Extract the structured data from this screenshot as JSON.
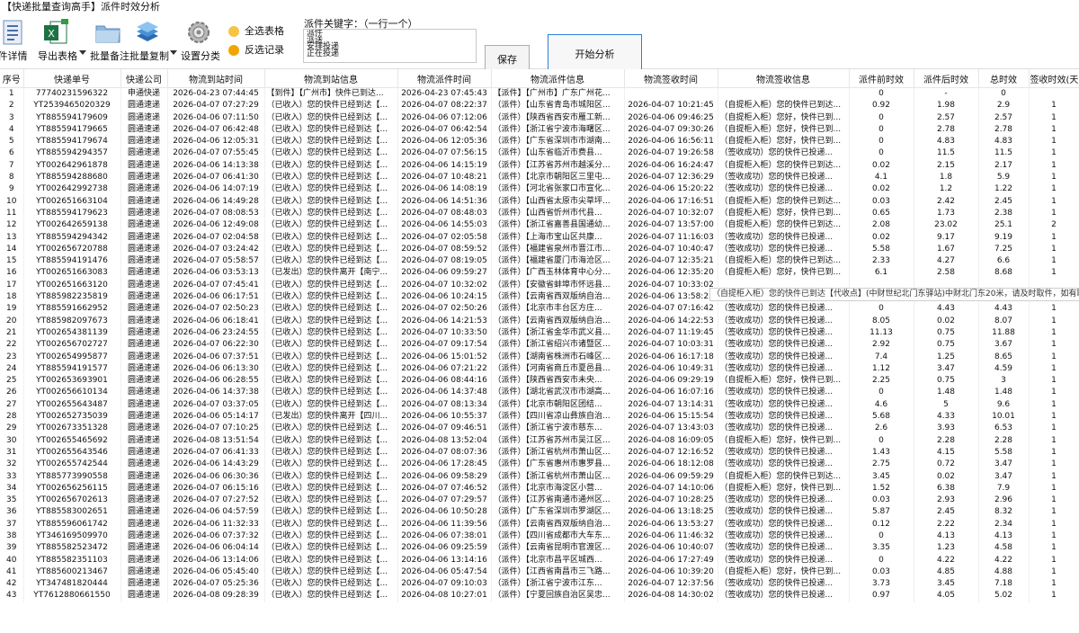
{
  "window_title": "【快递批量查询高手】派件时效分析",
  "toolbar": {
    "detail_label": "件详情",
    "export_label": "导出表格",
    "backup_label": "批量备注",
    "copy_label": "批量复制",
    "settings_label": "设置分类",
    "select_all_label": "全选表格",
    "invert_label": "反选记录",
    "keyword_label": "派件关键字：（一行一个）",
    "keywords": "派件\n派送\n安排投递\n正在投递",
    "save_label": "保存",
    "start_label": "开始分析"
  },
  "table": {
    "headers": [
      "序号",
      "快递单号",
      "快递公司",
      "物流到站时间",
      "物流到站信息",
      "物流派件时间",
      "物流派件信息",
      "物流签收时间",
      "物流签收信息",
      "派件前时效",
      "派件后时效",
      "总时效",
      "签收时效(天)"
    ],
    "rows": [
      [
        "1",
        "77740231596322",
        "申通快递",
        "2026-04-23 07:44:45",
        "【到件】【广州市】快件已到达...",
        "2026-04-23 07:45:43",
        "【派件】【广州市】广东广州花...",
        "",
        "",
        "0",
        "-",
        "0",
        ""
      ],
      [
        "2",
        "YT2539465020329",
        "圆通速递",
        "2026-04-07 07:27:29",
        "（已收入）您的快件已经到达【...",
        "2026-04-07 08:22:37",
        "（派件）【山东省青岛市城阳区...",
        "2026-04-07 10:21:45",
        "（自提柜入柜）您的快件已到达...",
        "0.92",
        "1.98",
        "2.9",
        "1"
      ],
      [
        "3",
        "YT885594179609",
        "圆通速递",
        "2026-04-06 07:11:50",
        "（已收入）您的快件已经到达【...",
        "2026-04-06 07:12:06",
        "（派件）【陕西省西安市雁工新...",
        "2026-04-06 09:46:25",
        "（自提柜入柜）您好，快件已到...",
        "0",
        "2.57",
        "2.57",
        "1"
      ],
      [
        "4",
        "YT885594179665",
        "圆通速递",
        "2026-04-07 06:42:48",
        "（已收入）您的快件已经到达【...",
        "2026-04-07 06:42:54",
        "（派件）【浙江省宁波市海曙区...",
        "2026-04-07 09:30:26",
        "（自提柜入柜）您好，快件已到...",
        "0",
        "2.78",
        "2.78",
        "1"
      ],
      [
        "5",
        "YT885594179674",
        "圆通速递",
        "2026-04-06 12:05:31",
        "（已收入）您的快件已经到达【...",
        "2026-04-06 12:05:36",
        "（派件）【广东省深圳市市湖南...",
        "2026-04-06 16:56:11",
        "（自提柜入柜）您好，快件已到...",
        "0",
        "4.83",
        "4.83",
        "1"
      ],
      [
        "6",
        "YT885594294357",
        "圆通速递",
        "2026-04-07 07:55:45",
        "（已收入）您的快件已经到达【...",
        "2026-04-07 07:56:15",
        "（派件）【山东省临沂市费县...",
        "2026-04-07 19:26:58",
        "（签收成功）您的快件已投递...",
        "0",
        "11.5",
        "11.5",
        "1"
      ],
      [
        "7",
        "YT002642961878",
        "圆通速递",
        "2026-04-06 14:13:38",
        "（已收入）您的快件已经到达【...",
        "2026-04-06 14:15:19",
        "（派件）【江苏省苏州市越溪分...",
        "2026-04-06 16:24:47",
        "（自提柜入柜）您的快件已到达...",
        "0.02",
        "2.15",
        "2.17",
        "1"
      ],
      [
        "8",
        "YT885594288680",
        "圆通速递",
        "2026-04-07 06:41:30",
        "（已收入）您的快件已经到达【...",
        "2026-04-07 10:48:21",
        "（派件）【北京市朝阳区三里屯...",
        "2026-04-07 12:36:29",
        "（签收成功）您的快件已投递...",
        "4.1",
        "1.8",
        "5.9",
        "1"
      ],
      [
        "9",
        "YT002642992738",
        "圆通速递",
        "2026-04-06 14:07:19",
        "（已收入）您的快件已经到达【...",
        "2026-04-06 14:08:19",
        "（派件）【河北省张家口市宣化...",
        "2026-04-06 15:20:22",
        "（签收成功）您的快件已投递...",
        "0.02",
        "1.2",
        "1.22",
        "1"
      ],
      [
        "10",
        "YT002651663104",
        "圆通速递",
        "2026-04-06 14:49:28",
        "（已收入）您的快件已经到达【...",
        "2026-04-06 14:51:36",
        "（派件）【山西省太原市尖草坪...",
        "2026-04-06 17:16:51",
        "（自提柜入柜）您的快件已到达...",
        "0.03",
        "2.42",
        "2.45",
        "1"
      ],
      [
        "11",
        "YT885594179623",
        "圆通速递",
        "2026-04-07 08:08:53",
        "（已收入）您的快件已经到达【...",
        "2026-04-07 08:48:03",
        "（派件）【山西省忻州市代县...",
        "2026-04-07 10:32:07",
        "（自提柜入柜）您好，快件已到...",
        "0.65",
        "1.73",
        "2.38",
        "1"
      ],
      [
        "12",
        "YT002642659138",
        "圆通速递",
        "2026-04-06 12:49:08",
        "（已收入）您的快件已经到达【...",
        "2026-04-06 14:55:03",
        "（派件）【浙江省嘉善县国通幼...",
        "2026-04-07 13:57:00",
        "（自提柜入柜）您的快件已到达...",
        "2.08",
        "23.02",
        "25.1",
        "2"
      ],
      [
        "13",
        "YT885594294342",
        "圆通速递",
        "2026-04-07 02:04:58",
        "（已收入）您的快件已经到达【...",
        "2026-04-07 02:05:58",
        "（派件）【上海市宝山区共康...",
        "2026-04-07 11:16:03",
        "（签收成功）您的快件已投递...",
        "0.02",
        "9.17",
        "9.19",
        "1"
      ],
      [
        "14",
        "YT002656720788",
        "圆通速递",
        "2026-04-07 03:24:42",
        "（已收入）您的快件已经到达【...",
        "2026-04-07 08:59:52",
        "（派件）【福建省泉州市晋江市...",
        "2026-04-07 10:40:47",
        "（签收成功）您的快件已投递...",
        "5.58",
        "1.67",
        "7.25",
        "1"
      ],
      [
        "15",
        "YT885594191476",
        "圆通速递",
        "2026-04-07 05:58:57",
        "（已收入）您的快件已经到达【...",
        "2026-04-07 08:19:05",
        "（派件）【福建省厦门市海沧区...",
        "2026-04-07 12:35:21",
        "（自提柜入柜）您的快件已到达...",
        "2.33",
        "4.27",
        "6.6",
        "1"
      ],
      [
        "16",
        "YT002651663083",
        "圆通速递",
        "2026-04-06 03:53:13",
        "（已发出）您的快件离开【南宁...",
        "2026-04-06 09:59:27",
        "（派件）【广西玉林体育中心分...",
        "2026-04-06 12:35:20",
        "（自提柜入柜）您好，快件已到...",
        "6.1",
        "2.58",
        "8.68",
        "1"
      ],
      [
        "17",
        "YT002651663120",
        "圆通速递",
        "2026-04-07 07:45:41",
        "（已收入）您的快件已经到达【...",
        "2026-04-07 10:32:02",
        "（派件）【安徽省蚌埠市怀远县...",
        "2026-04-07 10:33:02",
        "",
        "",
        "",
        "",
        ""
      ],
      [
        "18",
        "YT885982235819",
        "圆通速递",
        "2026-04-06 06:17:51",
        "（已收入）您的快件已经到达【...",
        "2026-04-06 10:24:15",
        "（派件）【云南省西双版纳自治...",
        "2026-04-06 13:58:23",
        "（签收成功）您的快件已投递...",
        "4.1",
        "3.57",
        "7.67",
        "1"
      ],
      [
        "19",
        "YT885591662952",
        "圆通速递",
        "2026-04-07 02:50:23",
        "（已收入）您的快件已经到达【...",
        "2026-04-07 02:50:26",
        "（派件）【北京市丰台区方庄...",
        "2026-04-07 07:16:42",
        "（签收成功）您的快件已投递...",
        "0",
        "4.43",
        "4.43",
        "1"
      ],
      [
        "20",
        "YT885982097673",
        "圆通速递",
        "2026-04-06 06:18:41",
        "（已收入）您的快件已经到达【...",
        "2026-04-06 14:21:53",
        "（派件）【云南省西双版纳自治...",
        "2026-04-06 14:22:53",
        "（签收成功）您的快件已投递...",
        "8.05",
        "0.02",
        "8.07",
        "1"
      ],
      [
        "21",
        "YT002654381139",
        "圆通速递",
        "2026-04-06 23:24:55",
        "（已收入）您的快件已经到达【...",
        "2026-04-07 10:33:50",
        "（派件）【浙江省金华市武义县...",
        "2026-04-07 11:19:45",
        "（签收成功）您的快件已投递...",
        "11.13",
        "0.75",
        "11.88",
        "1"
      ],
      [
        "22",
        "YT002656702727",
        "圆通速递",
        "2026-04-07 06:22:30",
        "（已收入）您的快件已经到达【...",
        "2026-04-07 09:17:54",
        "（派件）【浙江省绍兴市诸暨区...",
        "2026-04-07 10:03:31",
        "（签收成功）您的快件已投递...",
        "2.92",
        "0.75",
        "3.67",
        "1"
      ],
      [
        "23",
        "YT002654995877",
        "圆通速递",
        "2026-04-06 07:37:51",
        "（已收入）您的快件已经到达【...",
        "2026-04-06 15:01:52",
        "（派件）【湖南省株洲市石峰区...",
        "2026-04-06 16:17:18",
        "（签收成功）您的快件已投递...",
        "7.4",
        "1.25",
        "8.65",
        "1"
      ],
      [
        "24",
        "YT885594191577",
        "圆通速递",
        "2026-04-06 06:13:30",
        "（已收入）您的快件已经到达【...",
        "2026-04-06 07:21:22",
        "（派件）【河南省商丘市夏邑县...",
        "2026-04-06 10:49:31",
        "（签收成功）您的快件已投递...",
        "1.12",
        "3.47",
        "4.59",
        "1"
      ],
      [
        "25",
        "YT002653693901",
        "圆通速递",
        "2026-04-06 06:28:55",
        "（已收入）您的快件已经到达【...",
        "2026-04-06 08:44:16",
        "（派件）【陕西省西安市未央...",
        "2026-04-06 09:29:19",
        "（自提柜入柜）您好，快件已到...",
        "2.25",
        "0.75",
        "3",
        "1"
      ],
      [
        "26",
        "YT002656610134",
        "圆通速递",
        "2026-04-06 14:37:38",
        "（已收入）您的快件已经到达【...",
        "2026-04-06 14:37:48",
        "（派件）【湖北省武汉市市湖高...",
        "2026-04-06 16:07:16",
        "（签收成功）您的快件已投递...",
        "0",
        "1.48",
        "1.48",
        "1"
      ],
      [
        "27",
        "YT002655643487",
        "圆通速递",
        "2026-04-07 03:37:05",
        "（已收入）您的快件已经到达【...",
        "2026-04-07 08:13:34",
        "（派件）【北京市朝阳区团结...",
        "2026-04-07 13:14:31",
        "（签收成功）您的快件已投递...",
        "4.6",
        "5",
        "9.6",
        "1"
      ],
      [
        "28",
        "YT002652735039",
        "圆通速递",
        "2026-04-06 05:14:17",
        "（已发出）您的快件离开【四川...",
        "2026-04-06 10:55:37",
        "（派件）【四川省凉山彝族自治...",
        "2026-04-06 15:15:54",
        "（签收成功）您的快件已投递...",
        "5.68",
        "4.33",
        "10.01",
        "1"
      ],
      [
        "29",
        "YT002673351328",
        "圆通速递",
        "2026-04-07 07:10:25",
        "（已收入）您的快件已经到达【...",
        "2026-04-07 09:46:51",
        "（派件）【浙江省宁波市慈东...",
        "2026-04-07 13:43:03",
        "（签收成功）您的快件已投递...",
        "2.6",
        "3.93",
        "6.53",
        "1"
      ],
      [
        "30",
        "YT002655465692",
        "圆通速递",
        "2026-04-08 13:51:54",
        "（已收入）您的快件已经到达【...",
        "2026-04-08 13:52:04",
        "（派件）【江苏省苏州市吴江区...",
        "2026-04-08 16:09:05",
        "（自提柜入柜）您好，快件已到...",
        "0",
        "2.28",
        "2.28",
        "1"
      ],
      [
        "31",
        "YT002655643546",
        "圆通速递",
        "2026-04-07 06:41:33",
        "（已收入）您的快件已经到达【...",
        "2026-04-07 08:07:36",
        "（派件）【浙江省杭州市萧山区...",
        "2026-04-07 12:16:52",
        "（签收成功）您的快件已投递...",
        "1.43",
        "4.15",
        "5.58",
        "1"
      ],
      [
        "32",
        "YT002655742544",
        "圆通速递",
        "2026-04-06 14:43:29",
        "（已收入）您的快件已经到达【...",
        "2026-04-06 17:28:45",
        "（派件）【广东省惠州市惠罗县...",
        "2026-04-06 18:12:08",
        "（签收成功）您的快件已投递...",
        "2.75",
        "0.72",
        "3.47",
        "1"
      ],
      [
        "33",
        "YT885773990558",
        "圆通速递",
        "2026-04-06 06:30:36",
        "（已收入）您的快件已经到达【...",
        "2026-04-06 09:58:29",
        "（派件）【浙江省杭州市萧山区...",
        "2026-04-06 09:59:29",
        "（自提柜入柜）您的快件已到达...",
        "3.45",
        "0.02",
        "3.47",
        "1"
      ],
      [
        "34",
        "YT002656256115",
        "圆通速递",
        "2026-04-07 06:15:16",
        "（已收入）您的快件已经到达【...",
        "2026-04-07 07:46:52",
        "（派件）【北京市海淀区小营...",
        "2026-04-07 14:10:06",
        "（自提柜入柜）您好，快件已到...",
        "1.52",
        "6.38",
        "7.9",
        "1"
      ],
      [
        "35",
        "YT002656702613",
        "圆通速递",
        "2026-04-07 07:27:52",
        "（已收入）您的快件已经到达【...",
        "2026-04-07 07:29:57",
        "（派件）【江苏省南通市通州区...",
        "2026-04-07 10:28:25",
        "（签收成功）您的快件已投递...",
        "0.03",
        "2.93",
        "2.96",
        "1"
      ],
      [
        "36",
        "YT885583002651",
        "圆通速递",
        "2026-04-06 04:57:59",
        "（已收入）您的快件已经到达【...",
        "2026-04-06 10:50:28",
        "（派件）【广东省深圳市罗湖区...",
        "2026-04-06 13:18:25",
        "（签收成功）您的快件已投递...",
        "5.87",
        "2.45",
        "8.32",
        "1"
      ],
      [
        "37",
        "YT885596061742",
        "圆通速递",
        "2026-04-06 11:32:33",
        "（已收入）您的快件已经到达【...",
        "2026-04-06 11:39:56",
        "（派件）【云南省西双版纳自治...",
        "2026-04-06 13:53:27",
        "（签收成功）您的快件已投递...",
        "0.12",
        "2.22",
        "2.34",
        "1"
      ],
      [
        "38",
        "YT346169509970",
        "圆通速递",
        "2026-04-06 07:37:32",
        "（已收入）您的快件已经到达【...",
        "2026-04-06 07:38:01",
        "（派件）【四川省成都市大车东...",
        "2026-04-06 11:46:32",
        "（签收成功）您的快件已投递...",
        "0",
        "4.13",
        "4.13",
        "1"
      ],
      [
        "39",
        "YT885582523472",
        "圆通速递",
        "2026-04-06 06:04:14",
        "（已收入）您的快件已经到达【...",
        "2026-04-06 09:25:59",
        "（派件）【云南省昆明市官渡区...",
        "2026-04-06 10:40:07",
        "（签收成功）您的快件已投递...",
        "3.35",
        "1.23",
        "4.58",
        "1"
      ],
      [
        "40",
        "YT885582351103",
        "圆通速递",
        "2026-04-06 13:14:06",
        "（已收入）您的快件已经到达【...",
        "2026-04-06 13:14:16",
        "（派件）【北京市昌平区城西...",
        "2026-04-06 17:27:49",
        "（签收成功）您的快件已投递...",
        "0",
        "4.22",
        "4.22",
        "1"
      ],
      [
        "41",
        "YT885600213467",
        "圆通速递",
        "2026-04-06 05:45:40",
        "（已收入）您的快件已经到达【...",
        "2026-04-06 05:47:54",
        "（派件）【江西省南昌市三飞路...",
        "2026-04-06 10:39:20",
        "（自提柜入柜）您好，快件已到...",
        "0.03",
        "4.85",
        "4.88",
        "1"
      ],
      [
        "42",
        "YT347481820444",
        "圆通速递",
        "2026-04-07 05:25:36",
        "（已收入）您的快件已经到达【...",
        "2026-04-07 09:10:03",
        "（派件）【浙江省宁波市江东...",
        "2026-04-07 12:37:56",
        "（签收成功）您的快件已投递...",
        "3.73",
        "3.45",
        "7.18",
        "1"
      ],
      [
        "43",
        "YT7612880661550",
        "圆通速递",
        "2026-04-08 09:28:39",
        "（已收入）您的快件已经到达【...",
        "2026-04-08 10:27:01",
        "（派件）【宁夏回族自治区吴忠...",
        "2026-04-08 14:30:02",
        "（签收成功）您的快件已投递...",
        "0.97",
        "4.05",
        "5.02",
        "1"
      ]
    ]
  },
  "tooltip_text": "（自提柜入柜）您的快件已到达【代收点】(中财世纪北门东驿站)中财北门东20米，请及时取件，如有取件码"
}
